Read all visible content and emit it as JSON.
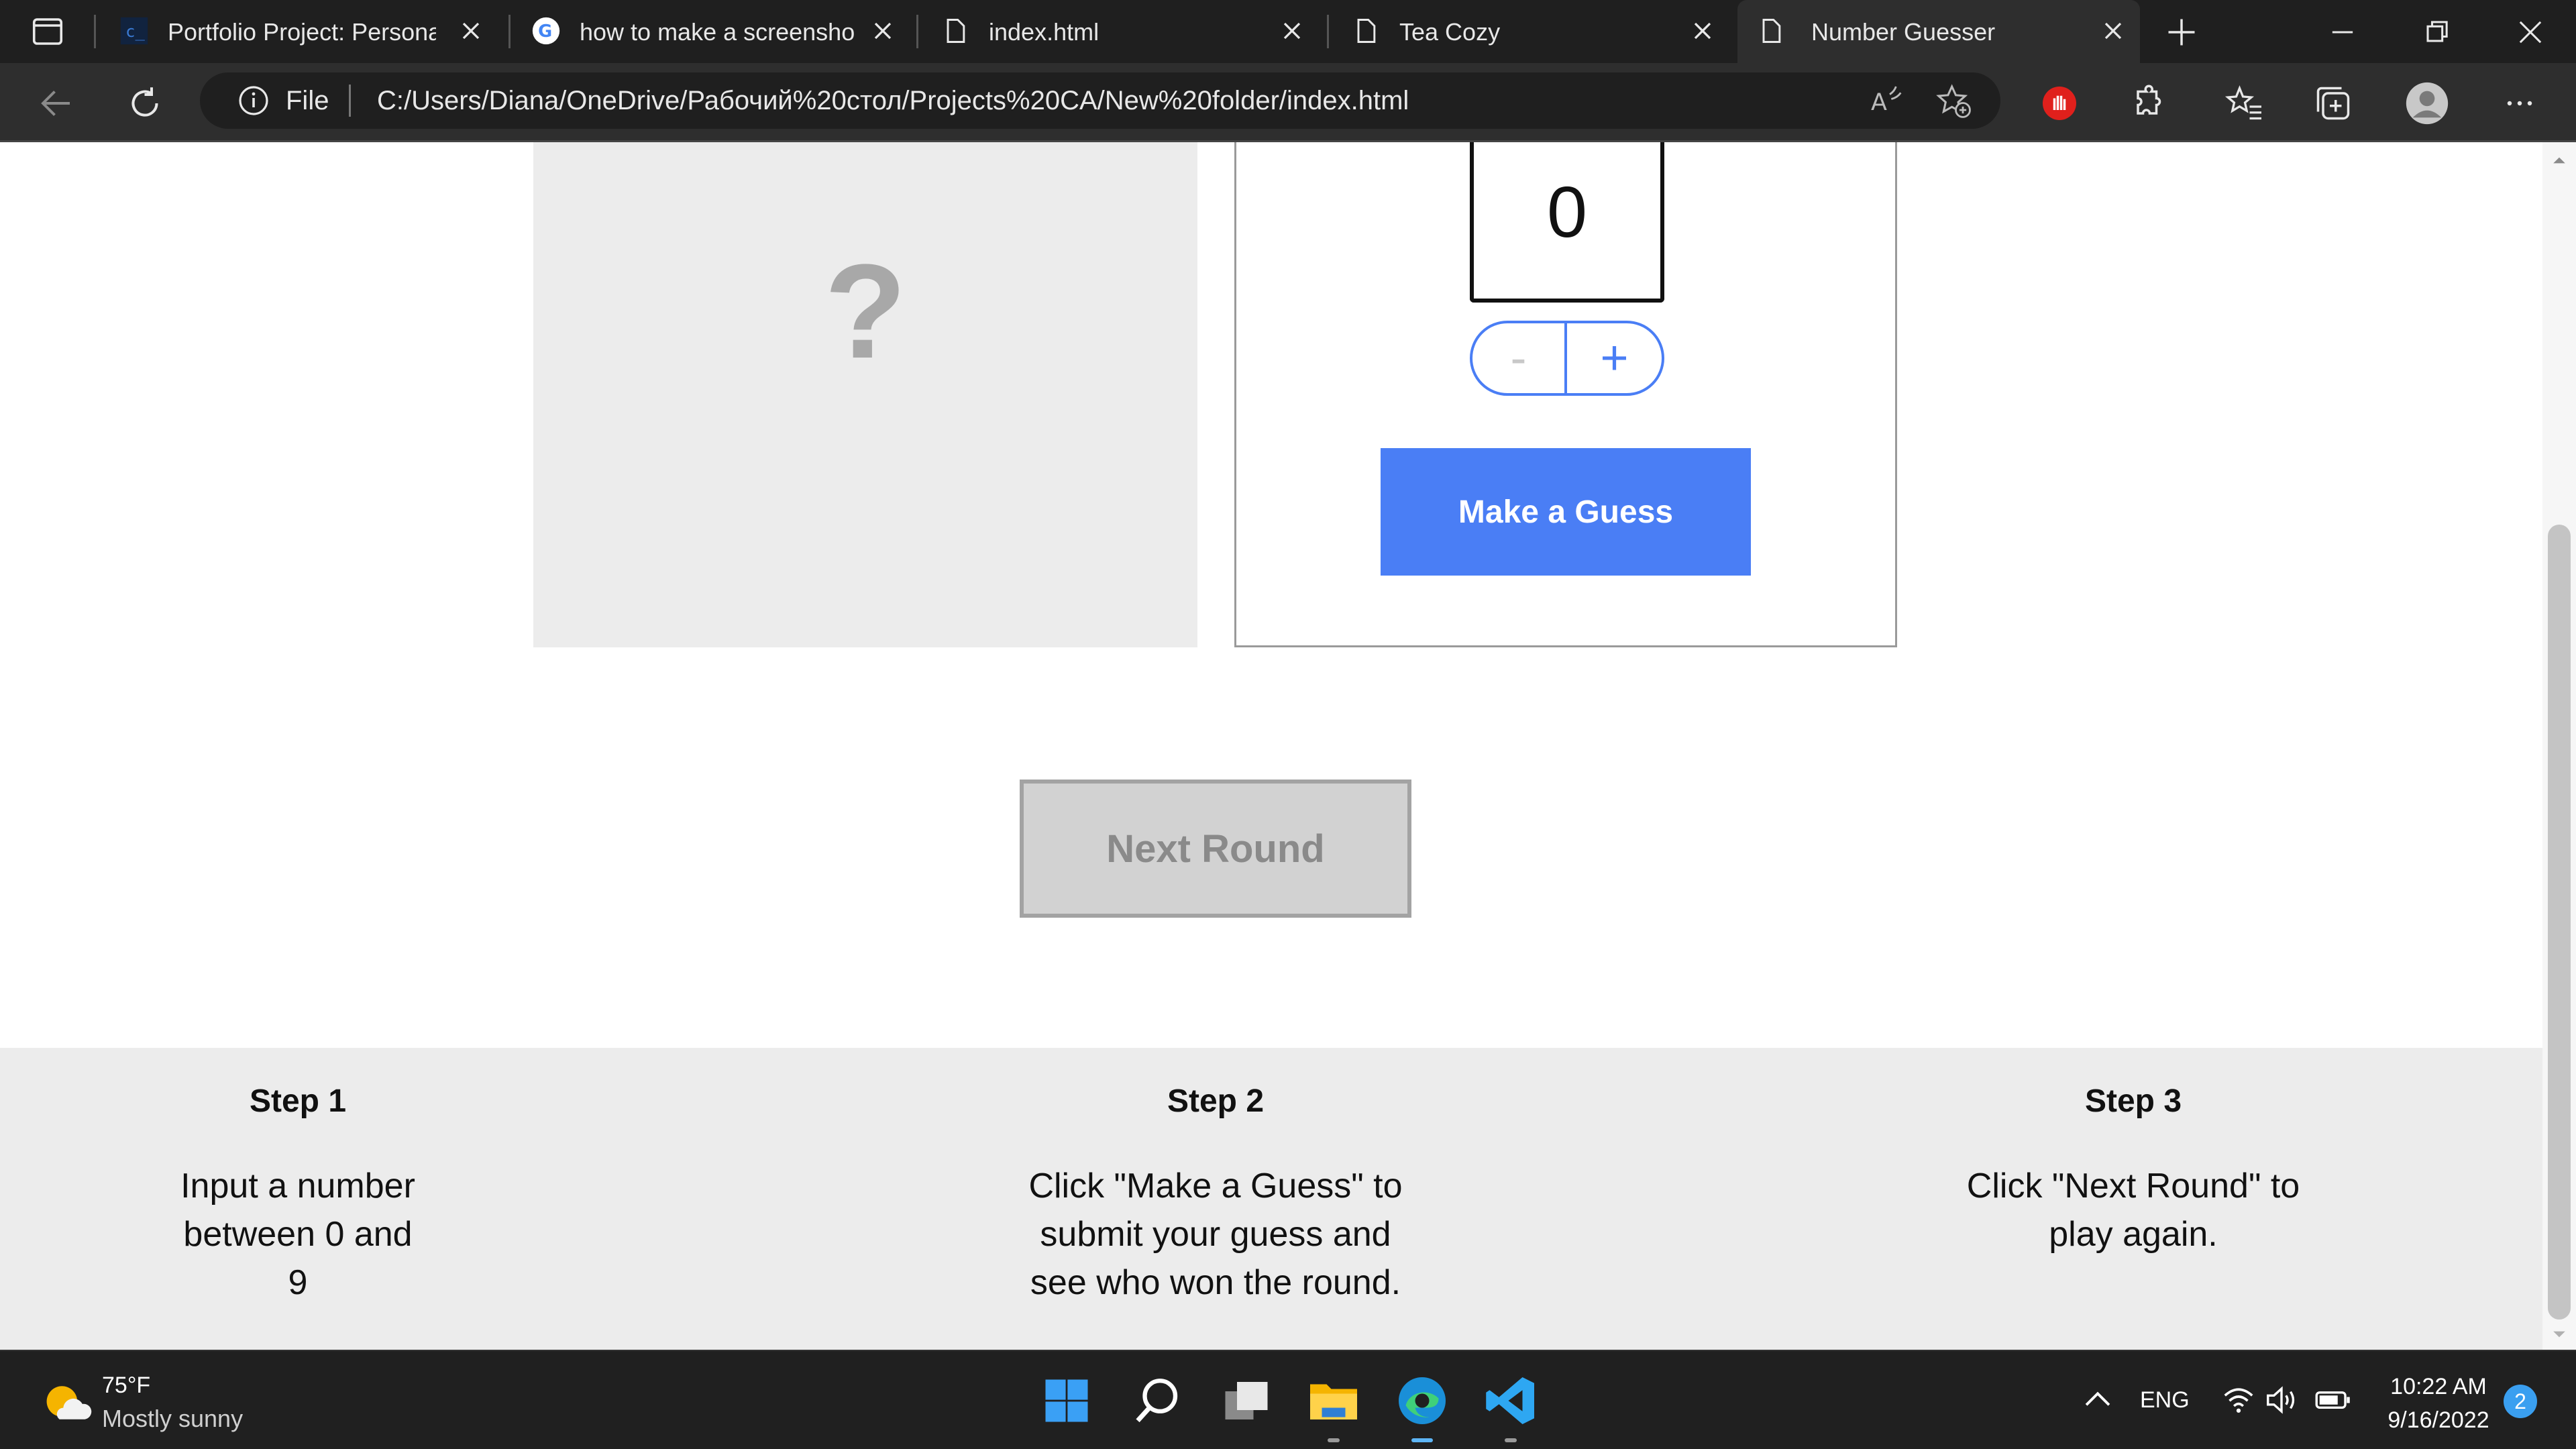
{
  "browser": {
    "tabs": [
      {
        "title": "Portfolio Project: Personal",
        "icon": "codecademy-icon",
        "active": false
      },
      {
        "title": "how to make a screenshot",
        "icon": "google-icon",
        "active": false
      },
      {
        "title": "index.html",
        "icon": "page-icon",
        "active": false
      },
      {
        "title": "Tea Cozy",
        "icon": "page-icon",
        "active": false
      },
      {
        "title": "Number Guesser",
        "icon": "page-icon",
        "active": true
      }
    ],
    "address": {
      "scheme_label": "File",
      "url": "C:/Users/Diana/OneDrive/Рабочий%20стол/Projects%20CA/New%20folder/index.html"
    }
  },
  "game": {
    "computer_guess": "?",
    "human_guess": "0",
    "minus_label": "-",
    "plus_label": "+",
    "guess_button": "Make a Guess",
    "next_round_button": "Next Round"
  },
  "instructions": [
    {
      "title": "Step 1",
      "text": "Input a number between 0 and 9"
    },
    {
      "title": "Step 2",
      "text": "Click \"Make a Guess\" to submit your guess and see who won the round."
    },
    {
      "title": "Step 3",
      "text": "Click \"Next Round\" to play again."
    }
  ],
  "taskbar": {
    "weather": {
      "temp": "75°F",
      "condition": "Mostly sunny"
    },
    "language": "ENG",
    "time": "10:22 AM",
    "date": "9/16/2022",
    "notifications": "2"
  },
  "colors": {
    "accent": "#4a7ef5",
    "panel_gray": "#ececec"
  }
}
